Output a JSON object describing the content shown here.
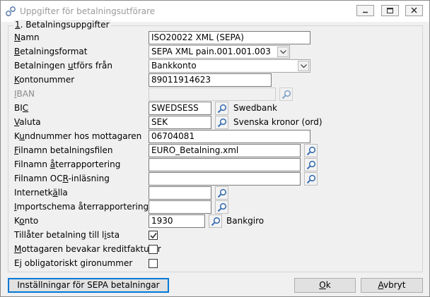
{
  "window": {
    "title": "Uppgifter för betalningsutförare",
    "controls": [
      "minimize-icon",
      "maximize-icon",
      "close-icon"
    ]
  },
  "group": {
    "title_prefix": "1",
    "title_rest": ". Betalningsuppgifter"
  },
  "fields": {
    "namn": {
      "label_u": "N",
      "label_rest": "amn",
      "value": "ISO20022 XML  (SEPA)"
    },
    "betalningsformat": {
      "label_u": "B",
      "label_rest": "etalningsformat",
      "value": "SEPA XML pain.001.001.003"
    },
    "utfors_fran": {
      "label_pre": "Betalningen ",
      "label_u": "u",
      "label_rest": "tförs från",
      "value": "Bankkonto"
    },
    "kontonummer": {
      "label_u": "K",
      "label_rest": "ontonummer",
      "value": "89011914623"
    },
    "iban": {
      "label_u": "I",
      "label_rest": "BAN",
      "value": ""
    },
    "bic": {
      "label_pre": "BI",
      "label_u": "C",
      "label_rest": "",
      "value": "SWEDSESS",
      "description": "Swedbank"
    },
    "valuta": {
      "label_u": "V",
      "label_rest": "aluta",
      "value": "SEK",
      "description": "Svenska kronor (ord)"
    },
    "kundnummer": {
      "label_pre": "K",
      "label_u": "u",
      "label_rest": "ndnummer hos mottagaren",
      "value": "06704081"
    },
    "filnamn_betalningsfil": {
      "label_u": "F",
      "label_rest": "ilnamn betalningsfilen",
      "value": "EURO_Betalning.xml"
    },
    "filnamn_aterrapportering": {
      "label_pre": "Filnamn ",
      "label_u": "å",
      "label_rest": "terrapportering",
      "value": ""
    },
    "filnamn_ocr": {
      "label_pre": "Filnamn OC",
      "label_u": "R",
      "label_rest": "-inläsning",
      "value": ""
    },
    "internetkalla": {
      "label_pre": "Internetk",
      "label_u": "ä",
      "label_rest": "lla",
      "value": ""
    },
    "importschema": {
      "label_u": "I",
      "label_rest": "mportschema återrapportering",
      "value": ""
    },
    "konto": {
      "label_pre": "K",
      "label_u": "o",
      "label_rest": "nto",
      "value": "1930",
      "description": "Bankgiro"
    }
  },
  "checkboxes": {
    "tillater_lista": {
      "label_pre": "Tillåter betalning till l",
      "label_u": "i",
      "label_rest": "sta",
      "checked": true
    },
    "bevakar_kreditfakturor": {
      "label_u": "M",
      "label_rest": "ottagaren bevakar kreditfakturor",
      "checked": false
    },
    "ej_obligatoriskt": {
      "label_pre": "E",
      "label_u": "j",
      "label_rest": " obligatoriskt gironummer",
      "checked": false
    }
  },
  "buttons": {
    "sepa_settings": "Inställningar för SEPA betalningar",
    "ok_u": "O",
    "ok_rest": "k",
    "cancel_u": "A",
    "cancel_rest": "vbryt"
  },
  "colors": {
    "accent": "#0078d7",
    "window_bg": "#f0f0f0",
    "search_icon": "#3a6fb0"
  }
}
